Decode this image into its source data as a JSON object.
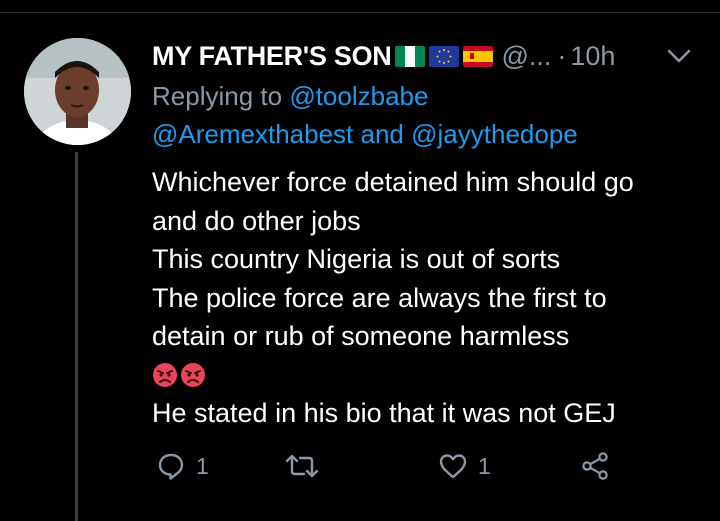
{
  "tweet": {
    "display_name": "MY FATHER'S SON",
    "flags": [
      "nigeria-flag-icon",
      "eu-flag-icon",
      "spain-flag-icon"
    ],
    "handle": "@...",
    "separator": "·",
    "time": "10h",
    "replying_to_label": "Replying to",
    "mentions": [
      "@toolzbabe",
      "@Aremexthabest",
      "@jayythedope"
    ],
    "mention_joiner": "and",
    "body_lines": [
      "Whichever force detained him should go",
      "and do other jobs",
      "This country Nigeria is out of sorts",
      "The police force are always the first to",
      "detain or rub of someone harmless"
    ],
    "emojis": [
      "angry-face-icon",
      "angry-face-icon"
    ],
    "body_last_line": "He stated in his bio that it was not GEJ"
  },
  "actions": {
    "reply_count": "1",
    "retweet_count": "",
    "like_count": "1"
  },
  "colors": {
    "background": "#000000",
    "text": "#ffffff",
    "muted": "#8b98a5",
    "link": "#1d9bf0",
    "angry_emoji": "#e8445a"
  }
}
